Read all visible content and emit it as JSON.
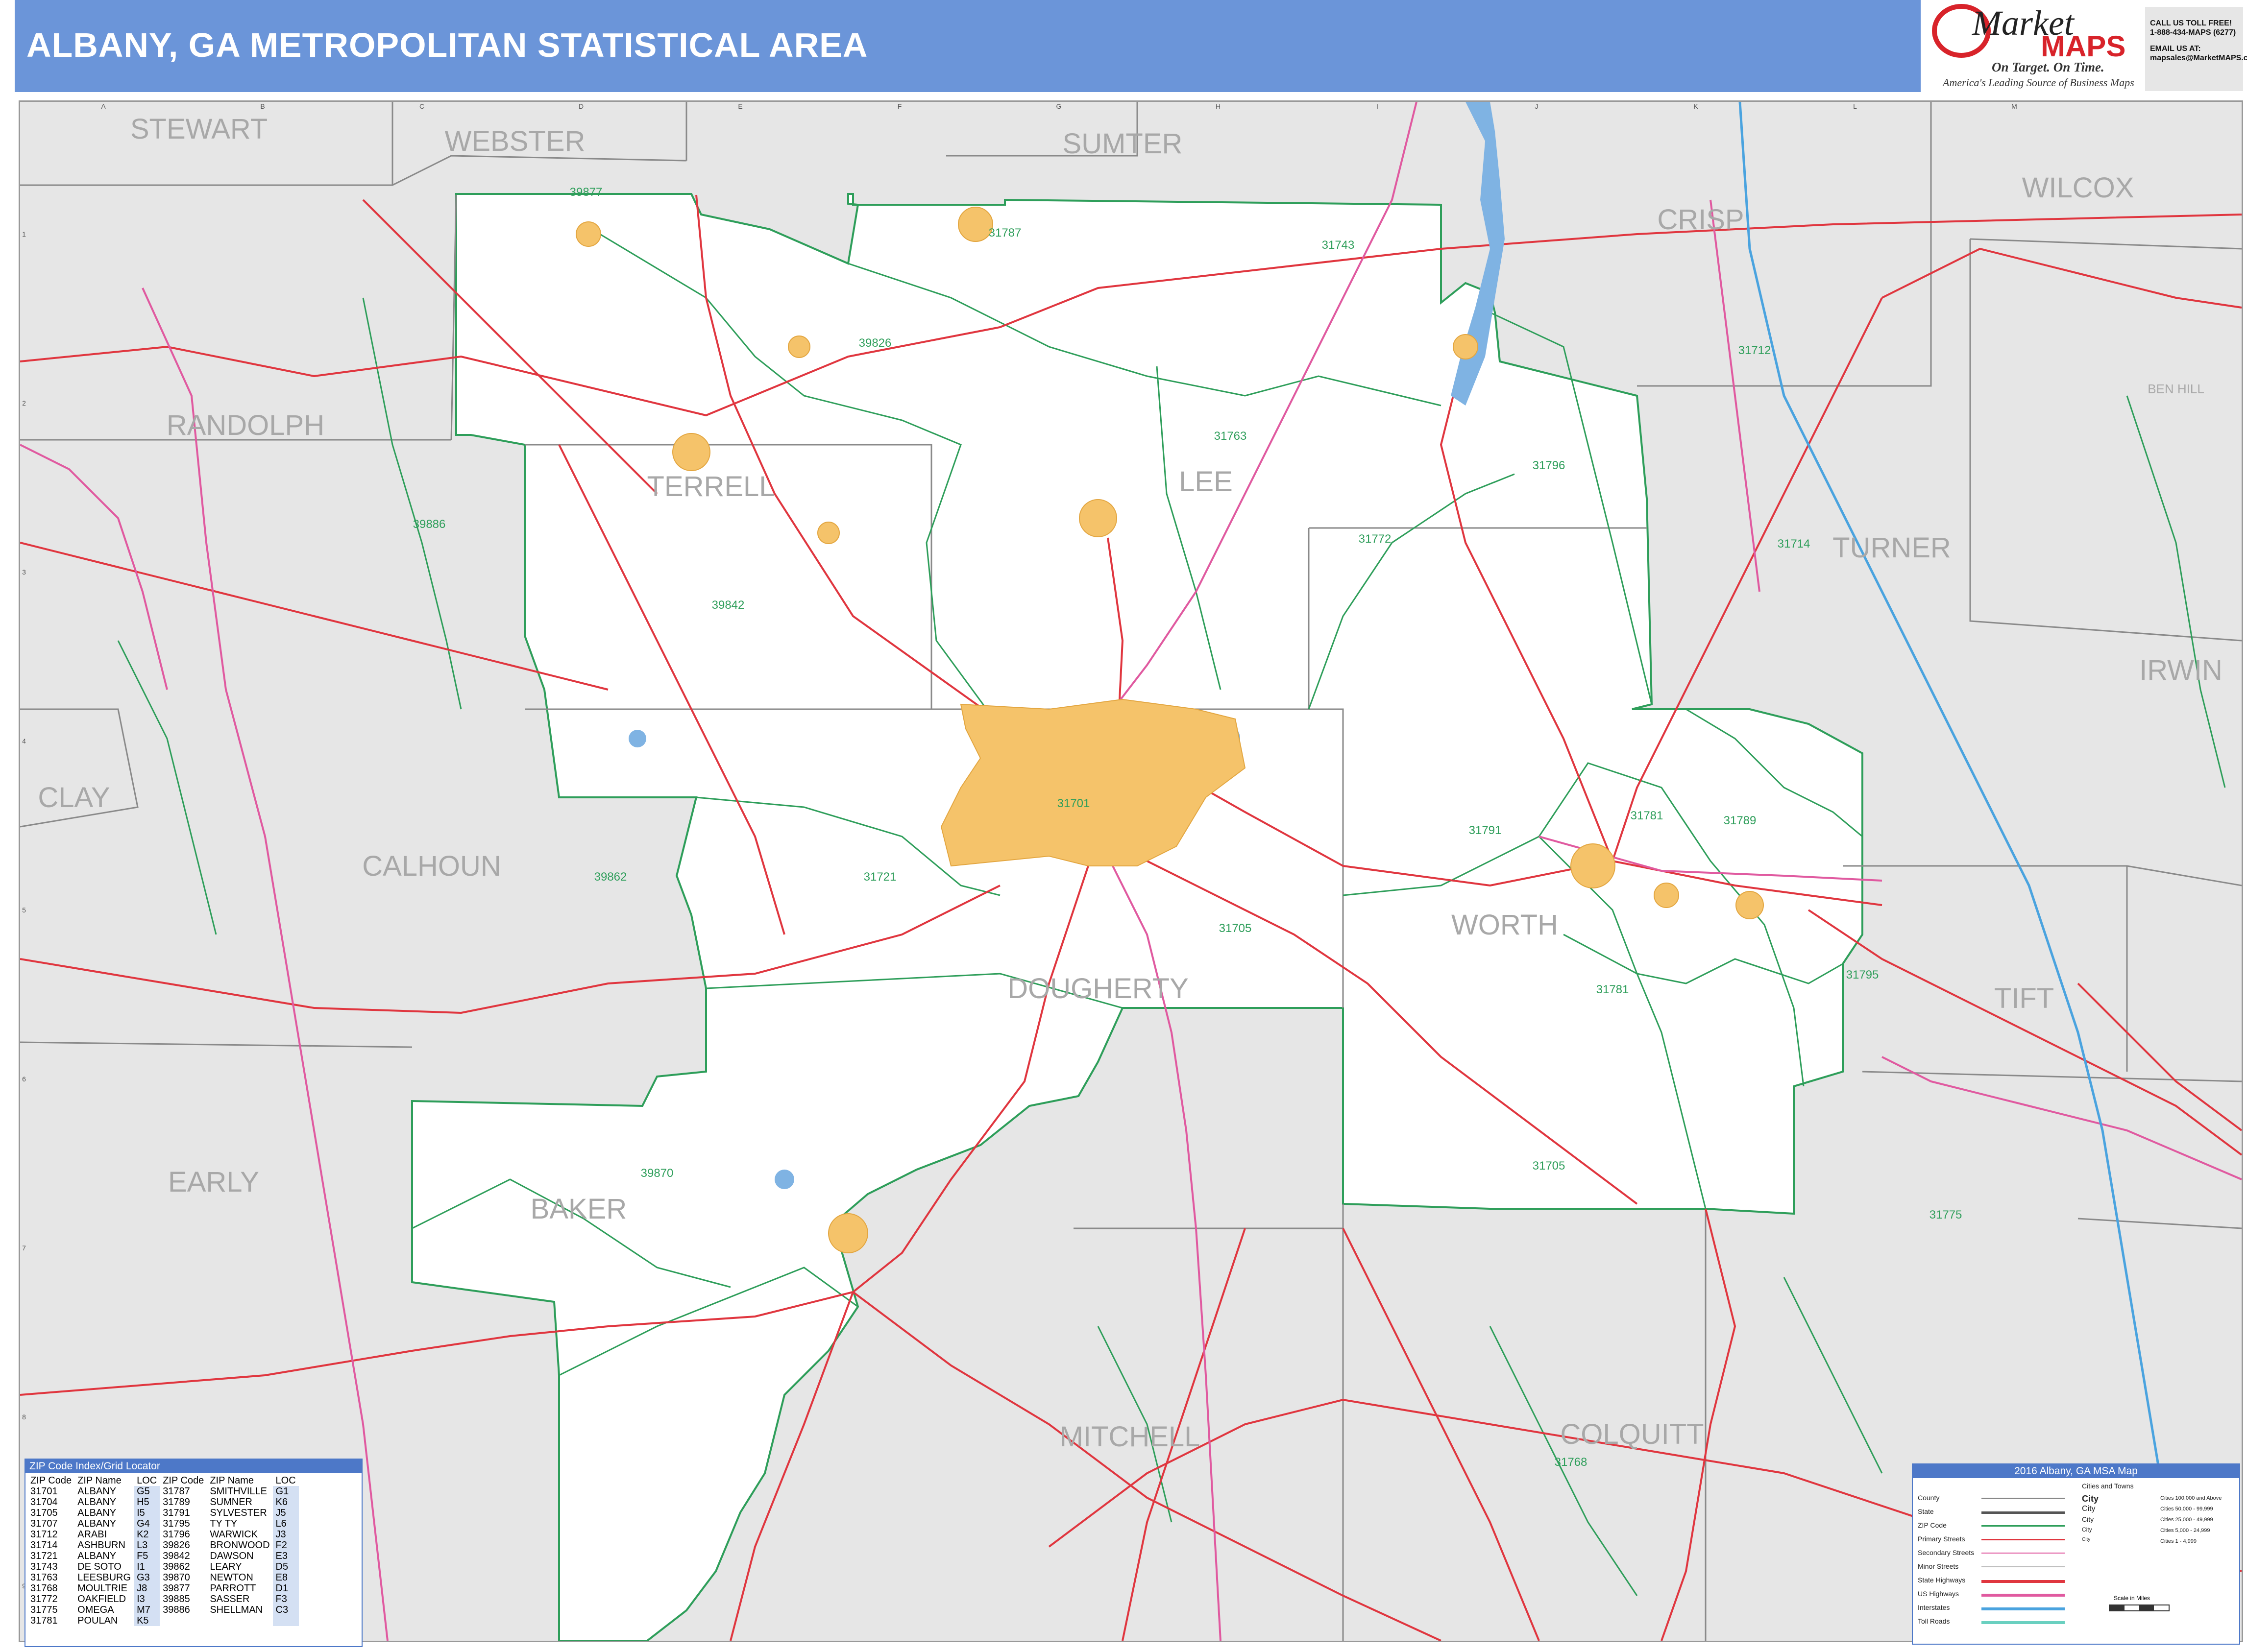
{
  "title": "ALBANY, GA METROPOLITAN STATISTICAL AREA",
  "logo": {
    "brand_top": "Market",
    "brand_bottom": "MAPS",
    "tagline": "On Target. On Time.",
    "subtagline": "America's Leading Source of Business Maps"
  },
  "contact": {
    "line1": "CALL US TOLL FREE!",
    "line2": "1-888-434-MAPS (6277)",
    "line3": "EMAIL US AT:",
    "line4": "mapsales@MarketMAPS.com"
  },
  "grid": {
    "columns": [
      "A",
      "B",
      "C",
      "D",
      "E",
      "F",
      "G",
      "H",
      "I",
      "J",
      "K",
      "L",
      "M"
    ],
    "rows": [
      "1",
      "2",
      "3",
      "4",
      "5",
      "6",
      "7",
      "8",
      "9"
    ]
  },
  "counties_outside": [
    "STEWART",
    "WEBSTER",
    "SUMTER",
    "CRISP",
    "WILCOX",
    "BEN HILL",
    "RANDOLPH",
    "TURNER",
    "IRWIN",
    "CLAY",
    "CALHOUN",
    "TIFT",
    "EARLY",
    "MITCHELL",
    "COLQUITT"
  ],
  "counties_inside": [
    "TERRELL",
    "LEE",
    "DOUGHERTY",
    "WORTH",
    "BAKER"
  ],
  "zip_labels": [
    "39877",
    "31787",
    "31743",
    "39826",
    "31712",
    "31763",
    "31796",
    "39886",
    "31772",
    "31714",
    "39842",
    "31701",
    "31791",
    "31781",
    "31789",
    "31721",
    "39862",
    "31705",
    "31795",
    "31781",
    "39870",
    "31705",
    "31775",
    "31768"
  ],
  "zip_index": {
    "header": "ZIP Code Index/Grid Locator",
    "columns": [
      "ZIP Code",
      "ZIP Name",
      "LOC",
      "ZIP Code",
      "ZIP Name",
      "LOC"
    ],
    "rows": [
      [
        "31701",
        "ALBANY",
        "G5",
        "31787",
        "SMITHVILLE",
        "G1"
      ],
      [
        "31704",
        "ALBANY",
        "H5",
        "31789",
        "SUMNER",
        "K6"
      ],
      [
        "31705",
        "ALBANY",
        "I5",
        "31791",
        "SYLVESTER",
        "J5"
      ],
      [
        "31707",
        "ALBANY",
        "G4",
        "31795",
        "TY TY",
        "L6"
      ],
      [
        "31712",
        "ARABI",
        "K2",
        "31796",
        "WARWICK",
        "J3"
      ],
      [
        "31714",
        "ASHBURN",
        "L3",
        "39826",
        "BRONWOOD",
        "F2"
      ],
      [
        "31721",
        "ALBANY",
        "F5",
        "39842",
        "DAWSON",
        "E3"
      ],
      [
        "31743",
        "DE SOTO",
        "I1",
        "39862",
        "LEARY",
        "D5"
      ],
      [
        "31763",
        "LEESBURG",
        "G3",
        "39870",
        "NEWTON",
        "E8"
      ],
      [
        "31768",
        "MOULTRIE",
        "J8",
        "39877",
        "PARROTT",
        "D1"
      ],
      [
        "31772",
        "OAKFIELD",
        "I3",
        "39885",
        "SASSER",
        "F3"
      ],
      [
        "31775",
        "OMEGA",
        "M7",
        "39886",
        "SHELLMAN",
        "C3"
      ],
      [
        "31781",
        "POULAN",
        "K5",
        "",
        "",
        ""
      ]
    ]
  },
  "legend": {
    "header": "2016 Albany, GA MSA Map",
    "items": [
      "County",
      "State",
      "ZIP Code",
      "Primary Streets",
      "Secondary Streets",
      "Minor Streets",
      "State Highways",
      "US Highways",
      "Interstates",
      "Toll Roads"
    ],
    "cities_header": "Cities and Towns",
    "city_label": "City",
    "city_ranges": [
      "Cities 100,000 and Above",
      "Cities 50,000 - 99,999",
      "Cities 25,000 - 49,999",
      "Cities 5,000 - 24,999",
      "Cities 1 - 4,999"
    ],
    "scale_label": "Scale in Miles",
    "colors": {
      "county": "#888888",
      "zip": "#2e9e5a",
      "primary": "#e0363f",
      "us_highway": "#e05aa0",
      "interstate": "#4aa3df",
      "toll": "#6ad0c0",
      "water": "#7fb3e3",
      "city": "#f5c36a"
    }
  }
}
